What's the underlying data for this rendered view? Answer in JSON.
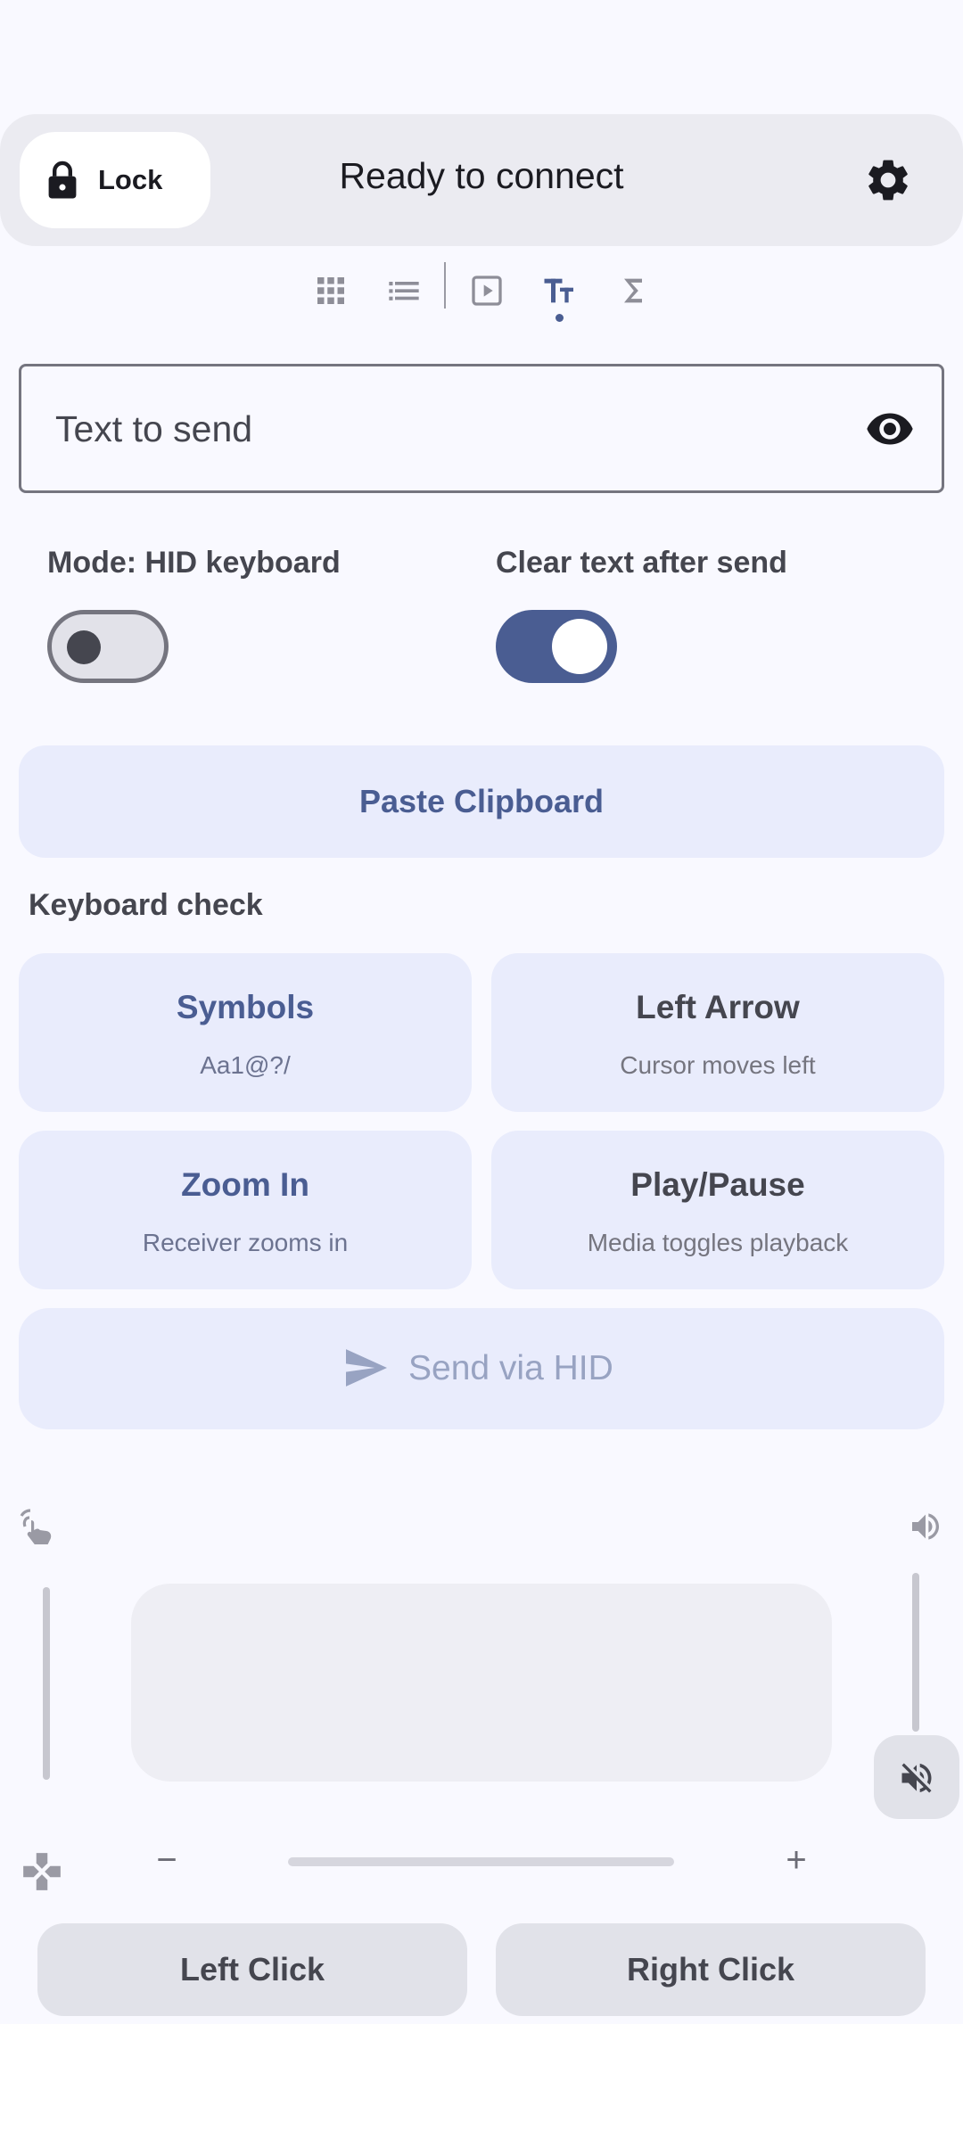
{
  "colors": {
    "accent": "#4a5d92",
    "surface": "#f9f9ff",
    "tonal_button": "#e9ecfc",
    "bar": "#ebebf1"
  },
  "topbar": {
    "lock_label": "Lock",
    "lock_icon": "lock-icon",
    "status": "Ready to connect",
    "settings_icon": "gear-icon"
  },
  "tabs": [
    {
      "icon": "grid-icon"
    },
    {
      "icon": "list-icon"
    },
    {
      "icon": "media-play-icon"
    },
    {
      "icon": "text-format-icon",
      "selected": true
    },
    {
      "icon": "sigma-icon"
    }
  ],
  "text_field": {
    "placeholder": "Text to send",
    "value": "",
    "visibility_icon": "eye-icon"
  },
  "toggles": {
    "hid_mode": {
      "label": "Mode: HID keyboard",
      "on": false
    },
    "clear_after_send": {
      "label": "Clear text after send",
      "on": true
    }
  },
  "paste_button": "Paste Clipboard",
  "keyboard_check": {
    "title": "Keyboard check",
    "cards": [
      {
        "title": "Symbols",
        "subtitle": "Aa1@?/"
      },
      {
        "title": "Left Arrow",
        "subtitle": "Cursor moves left"
      },
      {
        "title": "Zoom In",
        "subtitle": "Receiver zooms in"
      },
      {
        "title": "Play/Pause",
        "subtitle": "Media toggles playback"
      }
    ]
  },
  "send_button": {
    "label": "Send via HID",
    "icon": "send-icon",
    "enabled": false
  },
  "touchpad": {
    "gesture_icon": "touch-gesture-icon",
    "volume_icon": "volume-icon",
    "mute_icon": "volume-off-icon",
    "dpad_icon": "dpad-icon",
    "zoom_minus": "−",
    "zoom_plus": "+"
  },
  "mouse_buttons": {
    "left": "Left Click",
    "right": "Right Click"
  }
}
